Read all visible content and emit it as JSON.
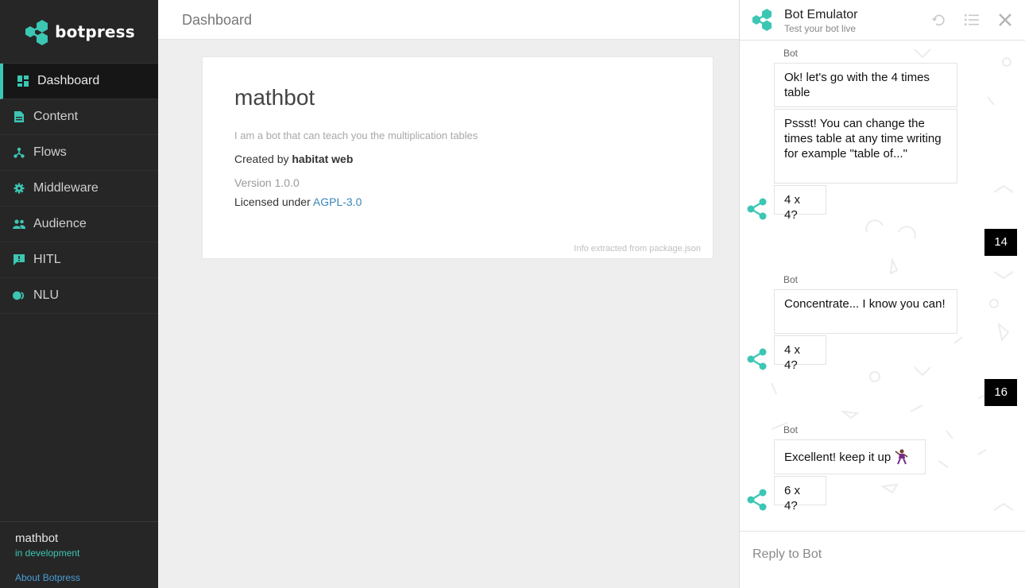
{
  "brand": {
    "name": "botpress",
    "accent": "#3cc6b4"
  },
  "sidebar": {
    "items": [
      {
        "label": "Dashboard",
        "icon": "dashboard-icon",
        "active": true
      },
      {
        "label": "Content",
        "icon": "document-icon"
      },
      {
        "label": "Flows",
        "icon": "flows-icon"
      },
      {
        "label": "Middleware",
        "icon": "gear-icon"
      },
      {
        "label": "Audience",
        "icon": "people-icon"
      },
      {
        "label": "HITL",
        "icon": "chat-alert-icon"
      },
      {
        "label": "NLU",
        "icon": "toggle-icon"
      }
    ],
    "footer": {
      "bot_name": "mathbot",
      "status": "in development",
      "about": "About Botpress"
    }
  },
  "topbar": {
    "title": "Dashboard"
  },
  "card": {
    "title": "mathbot",
    "description": "I am a bot that can teach you the multiplication tables",
    "created_by_prefix": "Created by",
    "author": "habitat web",
    "version": "Version 1.0.0",
    "license_prefix": "Licensed under",
    "license": "AGPL-3.0",
    "footnote": "Info extracted from package.json"
  },
  "emulator": {
    "title": "Bot Emulator",
    "subtitle": "Test your bot live",
    "messages": {
      "sender1": "Bot",
      "m1": "Ok! let's go with the 4 times table",
      "m2": "Pssst! You can change the times table at any time writing for example \"table of...\"",
      "m3": "4 x 4?",
      "u1": "14",
      "sender2": "Bot",
      "m4": "Concentrate... I know you can!",
      "m5": "4 x 4?",
      "u2": "16",
      "sender3": "Bot",
      "m6": "Excellent! keep it up",
      "m7": "6 x 4?"
    },
    "reply_placeholder": "Reply to Bot"
  }
}
